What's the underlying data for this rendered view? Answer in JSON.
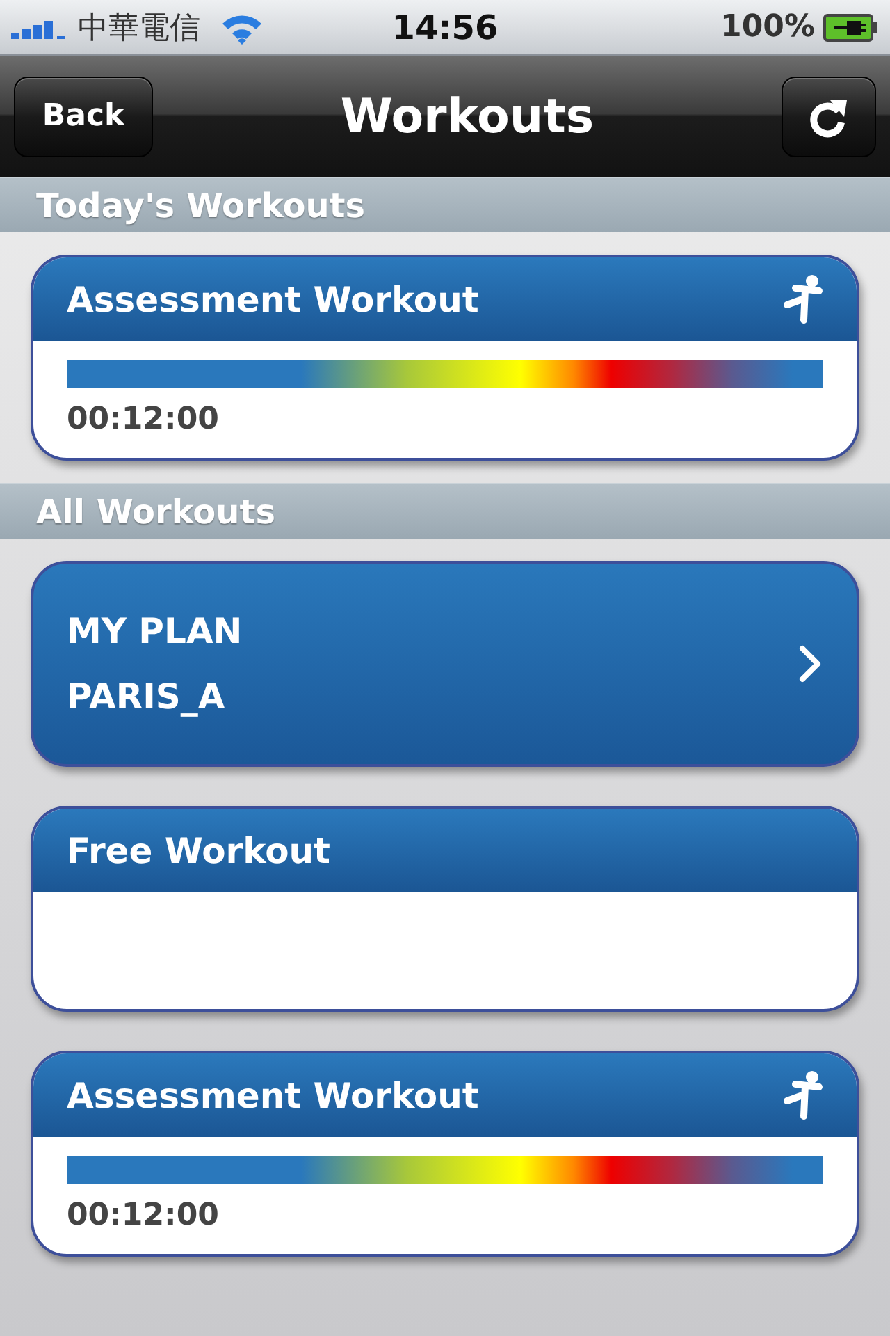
{
  "status_bar": {
    "carrier": "中華電信",
    "time": "14:56",
    "battery": "100%"
  },
  "nav_bar": {
    "back": "Back",
    "title": "Workouts"
  },
  "sections": [
    {
      "title": "Today's Workouts",
      "cards": [
        {
          "kind": "workout",
          "title": "Assessment Workout",
          "duration": "00:12:00"
        }
      ]
    },
    {
      "title": "All Workouts",
      "cards": [
        {
          "kind": "plan",
          "lines": [
            "MY PLAN",
            "PARIS_A"
          ]
        },
        {
          "kind": "free",
          "title": "Free Workout"
        },
        {
          "kind": "workout",
          "title": "Assessment Workout",
          "duration": "00:12:00"
        }
      ]
    }
  ]
}
